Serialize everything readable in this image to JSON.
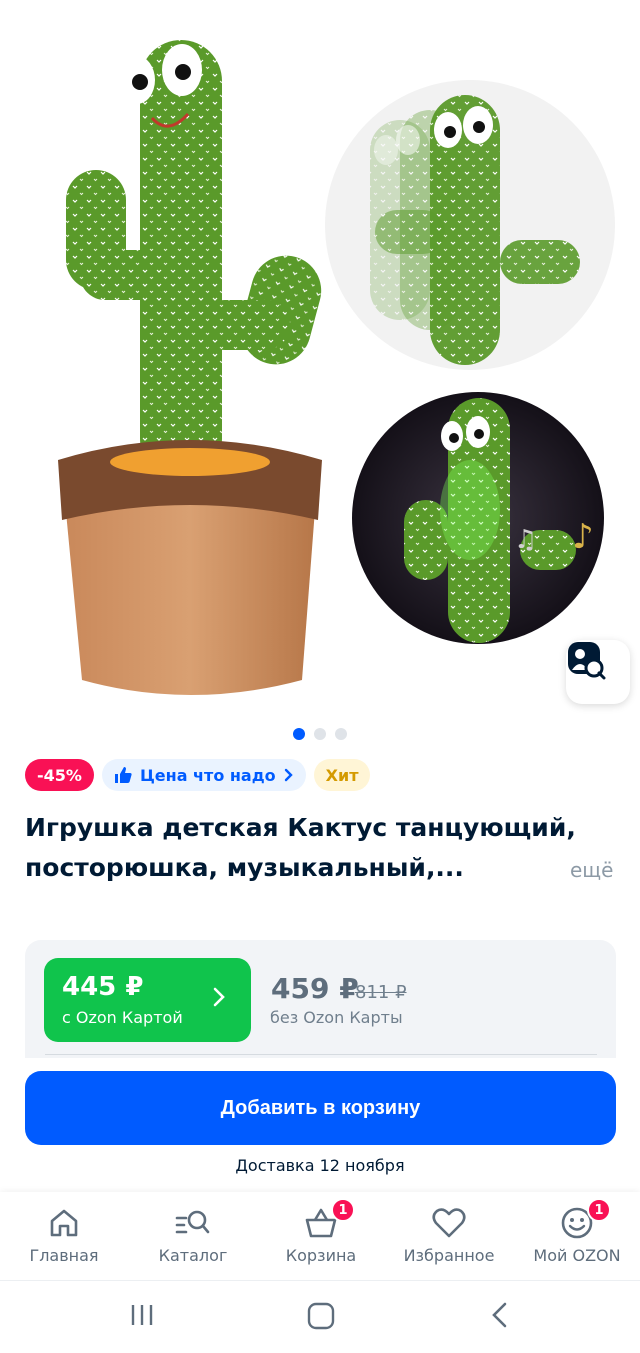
{
  "product": {
    "badges": {
      "discount": "-45%",
      "price_label": "Цена что надо",
      "hit": "Хит"
    },
    "title": "Игрушка детская Кактус танцующий, посторюшка, музыкальный,...",
    "more_label": "ещё"
  },
  "gallery": {
    "image_count": 3,
    "active_index": 0
  },
  "pricing": {
    "ozon_card_price": "445 ₽",
    "ozon_card_label": "с Ozon Картой",
    "regular_price": "459 ₽",
    "old_price": "811 ₽",
    "regular_label": "без Ozon Карты"
  },
  "cart": {
    "add_button": "Добавить в корзину",
    "delivery": "Доставка 12 ноября"
  },
  "tabbar": {
    "items": [
      {
        "label": "Главная",
        "icon": "home-icon"
      },
      {
        "label": "Каталог",
        "icon": "catalog-search-icon"
      },
      {
        "label": "Корзина",
        "icon": "basket-icon",
        "badge": "1"
      },
      {
        "label": "Избранное",
        "icon": "heart-icon"
      },
      {
        "label": "Мой OZON",
        "icon": "smiley-icon",
        "badge": "1"
      }
    ]
  },
  "colors": {
    "accent": "#005bff",
    "ozon_green": "#10c44c",
    "discount_pink": "#f91155"
  }
}
